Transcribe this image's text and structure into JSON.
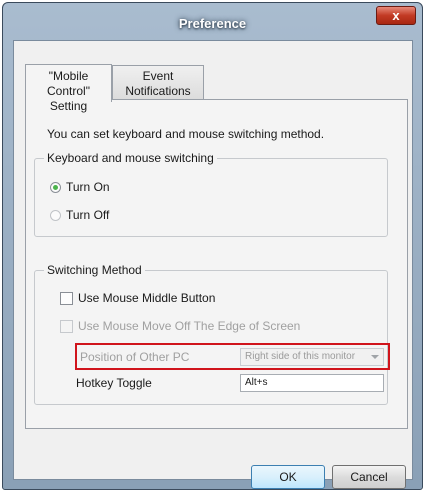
{
  "window": {
    "title": "Preference",
    "close_glyph": "x"
  },
  "tabs": [
    {
      "line1": "\"Mobile Control\"",
      "line2": "Setting",
      "active": true
    },
    {
      "line1": "Event",
      "line2": "Notifications",
      "active": false
    }
  ],
  "description": "You can set keyboard and mouse switching method.",
  "switching_group": {
    "legend": "Keyboard and mouse switching",
    "options": [
      {
        "label": "Turn On",
        "selected": true
      },
      {
        "label": "Turn Off",
        "selected": false
      }
    ]
  },
  "method_group": {
    "legend": "Switching Method",
    "middle_button": {
      "label": "Use Mouse Middle Button",
      "checked": false
    },
    "edge_of_screen": {
      "label": "Use Mouse Move Off The Edge of Screen",
      "checked": false,
      "enabled": false
    },
    "position": {
      "label": "Position of Other PC",
      "value": "Right side of this monitor",
      "enabled": false
    },
    "hotkey": {
      "label": "Hotkey Toggle",
      "value": "Alt+s"
    }
  },
  "buttons": {
    "ok": "OK",
    "cancel": "Cancel"
  },
  "colors": {
    "highlight": "#d0141c",
    "radio_selected": "#4bb34b"
  }
}
